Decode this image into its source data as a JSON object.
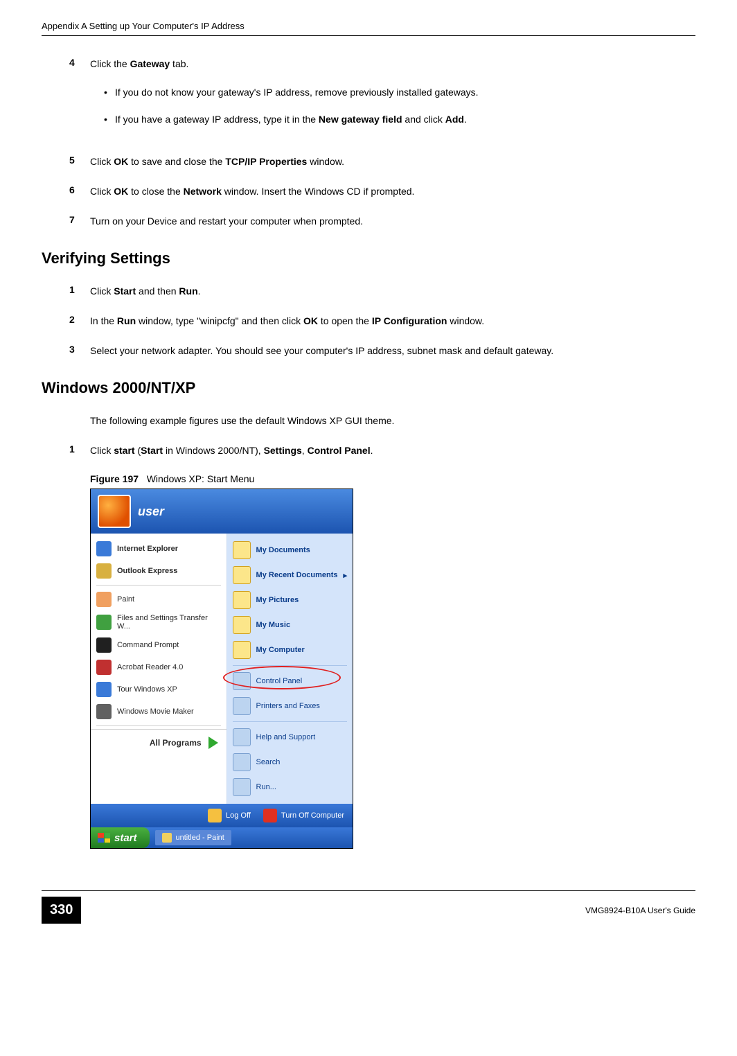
{
  "header": "Appendix A Setting up Your Computer's IP Address",
  "steps1": [
    {
      "num": "4",
      "parts": [
        {
          "t": "Click the "
        },
        {
          "b": "Gateway"
        },
        {
          "t": " tab."
        }
      ],
      "bullets": [
        [
          {
            "t": "If you do not know your gateway's IP address, remove previously installed gateways."
          }
        ],
        [
          {
            "t": "If you have a gateway IP address, type it in the "
          },
          {
            "b": "New gateway field"
          },
          {
            "t": " and click "
          },
          {
            "b": "Add"
          },
          {
            "t": "."
          }
        ]
      ]
    },
    {
      "num": "5",
      "parts": [
        {
          "t": "Click "
        },
        {
          "b": "OK"
        },
        {
          "t": " to save and close the "
        },
        {
          "b": "TCP/IP Properties"
        },
        {
          "t": " window."
        }
      ]
    },
    {
      "num": "6",
      "parts": [
        {
          "t": "Click "
        },
        {
          "b": "OK"
        },
        {
          "t": " to close the "
        },
        {
          "b": "Network"
        },
        {
          "t": " window. Insert the Windows CD if prompted."
        }
      ]
    },
    {
      "num": "7",
      "parts": [
        {
          "t": "Turn on your Device and restart your computer when prompted."
        }
      ]
    }
  ],
  "h2a": "Verifying Settings",
  "steps2": [
    {
      "num": "1",
      "parts": [
        {
          "t": "Click "
        },
        {
          "b": "Start"
        },
        {
          "t": " and then "
        },
        {
          "b": "Run"
        },
        {
          "t": "."
        }
      ]
    },
    {
      "num": "2",
      "parts": [
        {
          "t": "In the "
        },
        {
          "b": "Run"
        },
        {
          "t": " window, type \"winipcfg\" and then click "
        },
        {
          "b": "OK"
        },
        {
          "t": " to open the "
        },
        {
          "b": "IP Configuration"
        },
        {
          "t": " window."
        }
      ]
    },
    {
      "num": "3",
      "parts": [
        {
          "t": "Select your network adapter. You should see your computer's IP address, subnet mask and default gateway."
        }
      ]
    }
  ],
  "h2b": "Windows 2000/NT/XP",
  "intro": "The following example figures use the default Windows XP GUI theme.",
  "steps3": [
    {
      "num": "1",
      "parts": [
        {
          "t": "Click "
        },
        {
          "b": "start"
        },
        {
          "t": " ("
        },
        {
          "b": "Start"
        },
        {
          "t": " in Windows 2000/NT), "
        },
        {
          "b": "Settings"
        },
        {
          "t": ", "
        },
        {
          "b": "Control Panel"
        },
        {
          "t": "."
        }
      ]
    }
  ],
  "figure_label": "Figure 197",
  "figure_title": "Windows XP: Start Menu",
  "startmenu": {
    "user": "user",
    "left": [
      "Internet Explorer",
      "Outlook Express",
      "Paint",
      "Files and Settings Transfer W...",
      "Command Prompt",
      "Acrobat Reader 4.0",
      "Tour Windows XP",
      "Windows Movie Maker"
    ],
    "left_colors": [
      "#3a7ad8",
      "#d8b040",
      "#f0a060",
      "#40a040",
      "#202020",
      "#c03030",
      "#3a7ad8",
      "#606060"
    ],
    "right": [
      "My Documents",
      "My Recent Documents",
      "My Pictures",
      "My Music",
      "My Computer",
      "Control Panel",
      "Printers and Faxes",
      "Help and Support",
      "Search",
      "Run..."
    ],
    "right_arrow_index": 1,
    "highlight_index": 5,
    "all_programs": "All Programs",
    "logoff": "Log Off",
    "turnoff": "Turn Off Computer",
    "start": "start",
    "task": "untitled - Paint"
  },
  "page_num": "330",
  "footer_text": "VMG8924-B10A User's Guide"
}
